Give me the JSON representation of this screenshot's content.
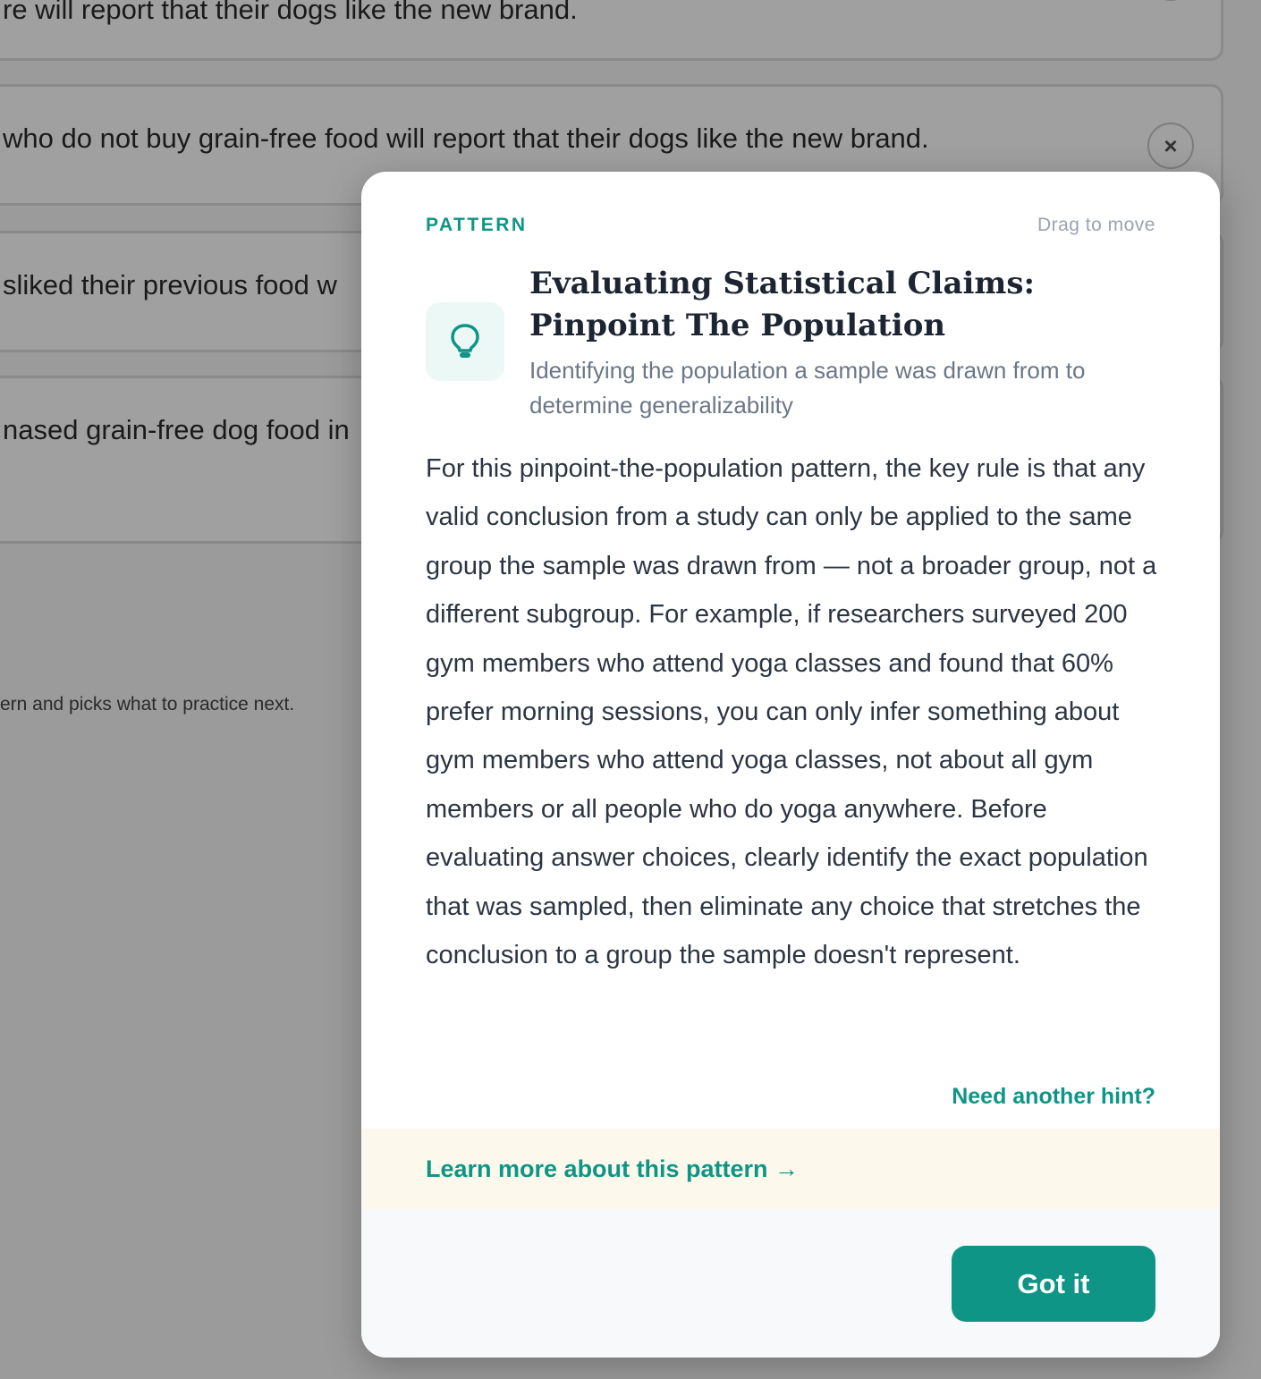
{
  "background": {
    "choices": [
      {
        "text": "re will report that their dogs like the new brand.",
        "close_glyph": "×"
      },
      {
        "text": "who do not buy grain-free food will report that their dogs like the new brand.",
        "close_glyph": "×"
      },
      {
        "text": "sliked their previous food w",
        "close_glyph": ""
      },
      {
        "text": "nased grain-free dog food in",
        "close_glyph": ""
      }
    ],
    "note": "ern and picks what to practice next."
  },
  "modal": {
    "label": "PATTERN",
    "drag_hint": "Drag to move",
    "icon": "lightbulb-icon",
    "title": "Evaluating Statistical Claims: Pinpoint The Population",
    "subtitle": "Identifying the population a sample was drawn from to determine generalizability",
    "body": "For this pinpoint-the-population pattern, the key rule is that any valid conclusion from a study can only be applied to the same group the sample was drawn from — not a broader group, not a different subgroup. For example, if researchers surveyed 200 gym members who attend yoga classes and found that 60% prefer morning sessions, you can only infer something about gym members who attend yoga classes, not about all gym members or all people who do yoga anywhere. Before evaluating answer choices, clearly identify the exact population that was sampled, then eliminate any choice that stretches the conclusion to a group the sample doesn't represent.",
    "another_hint": "Need another hint?",
    "learn_more": "Learn more about this pattern →",
    "got_it": "Got it"
  },
  "colors": {
    "accent": "#0f9585",
    "overlay": "#9b9b9b",
    "learn_band": "#fcf8ec",
    "footer": "#f7f9fb"
  }
}
